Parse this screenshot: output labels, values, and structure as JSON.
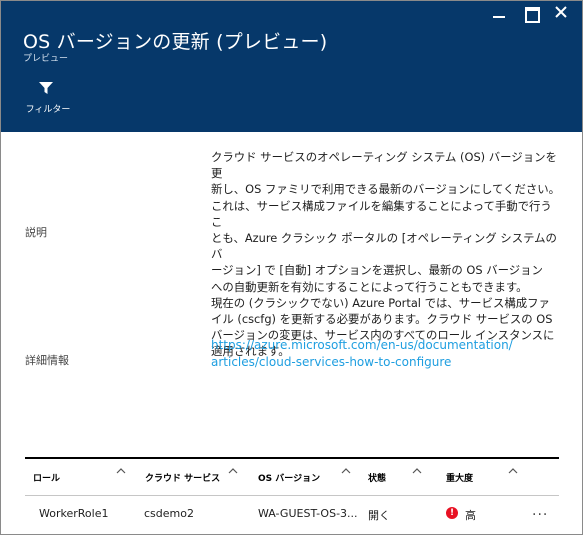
{
  "blade": {
    "title": "OS バージョンの更新 (プレビュー)",
    "subtitle": "プレビュー"
  },
  "toolbar": {
    "filter_label": "フィルター",
    "filter_icon": "filter-icon"
  },
  "window_controls": {
    "minimize_icon": "minimize-icon",
    "maximize_icon": "maximize-icon",
    "close_icon": "close-icon"
  },
  "properties": {
    "description_label": "説明",
    "description_lines": [
      "クラウド サービスのオペレーティング システム (OS) バージョンを更",
      "新し、OS ファミリで利用できる最新のバージョンにしてください。",
      "これは、サービス構成ファイルを編集することによって手動で行うこ",
      "とも、Azure クラシック ポータルの [オペレーティング システムのバ",
      "ージョン] で [自動] オプションを選択し、最新の OS バージョン",
      "への自動更新を有効にすることによって行うこともできます。",
      "現在の (クラシックでない) Azure Portal では、サービス構成ファ",
      "イル (cscfg) を更新する必要があります。クラウド サービスの OS",
      "バージョンの変更は、サービス内のすべてのロール インスタンスに",
      "適用されます。"
    ],
    "more_info_label": "詳細情報",
    "more_info_link_lines": [
      "https://azure.microsoft.com/en-us/documentation/",
      "articles/cloud-services-how-to-configure"
    ]
  },
  "grid": {
    "columns": [
      "ロール",
      "クラウド サービス",
      "OS バージョン",
      "状態",
      "重大度"
    ],
    "rows": [
      {
        "role": "WorkerRole1",
        "cloud_service": "csdemo2",
        "os_version": "WA-GUEST-OS-3...",
        "state": "開く",
        "severity": "高",
        "severity_icon": "error-icon",
        "severity_color": "#e81123",
        "more": "..."
      }
    ]
  },
  "colors": {
    "header_bg": "#06386a",
    "link": "#1e9ee0"
  }
}
